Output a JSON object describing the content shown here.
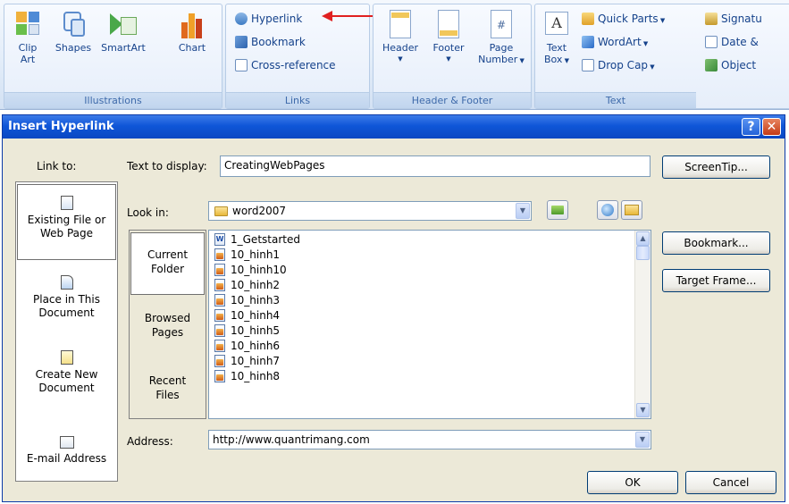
{
  "ribbon": {
    "illustrations": {
      "label": "Illustrations",
      "clip_art_1": "Clip",
      "clip_art_2": "Art",
      "shapes": "Shapes",
      "smartart": "SmartArt",
      "chart": "Chart"
    },
    "links": {
      "label": "Links",
      "hyperlink": "Hyperlink",
      "bookmark": "Bookmark",
      "cross_reference": "Cross-reference"
    },
    "header_footer": {
      "label": "Header & Footer",
      "header": "Header",
      "footer": "Footer",
      "page_number_1": "Page",
      "page_number_2": "Number"
    },
    "text": {
      "label": "Text",
      "text_box_1": "Text",
      "text_box_2": "Box",
      "quick_parts": "Quick Parts",
      "wordart": "WordArt",
      "drop_cap": "Drop Cap",
      "signature": "Signatu",
      "date_time": "Date &",
      "object": "Object"
    }
  },
  "dialog": {
    "title": "Insert Hyperlink",
    "help": "?",
    "close": "✕",
    "link_to_label": "Link to:",
    "text_to_display_label": "Text to display:",
    "text_to_display_value": "CreatingWebPages",
    "screentip": "ScreenTip...",
    "look_in_label": "Look in:",
    "look_in_value": "word2007",
    "bookmark": "Bookmark...",
    "target_frame": "Target Frame...",
    "address_label": "Address:",
    "address_value": "http://www.quantrimang.com",
    "ok": "OK",
    "cancel": "Cancel",
    "link_to": [
      {
        "line1": "Existing File or",
        "line2": "Web Page"
      },
      {
        "line1": "Place in This",
        "line2": "Document"
      },
      {
        "line1": "Create New",
        "line2": "Document"
      },
      {
        "line1": "E-mail Address",
        "line2": ""
      }
    ],
    "folder_tabs": [
      {
        "line1": "Current",
        "line2": "Folder"
      },
      {
        "line1": "Browsed",
        "line2": "Pages"
      },
      {
        "line1": "Recent",
        "line2": "Files"
      }
    ],
    "files": [
      {
        "name": "1_Getstarted",
        "type": "doc"
      },
      {
        "name": "10_hinh1",
        "type": "img"
      },
      {
        "name": "10_hinh10",
        "type": "img"
      },
      {
        "name": "10_hinh2",
        "type": "img"
      },
      {
        "name": "10_hinh3",
        "type": "img"
      },
      {
        "name": "10_hinh4",
        "type": "img"
      },
      {
        "name": "10_hinh5",
        "type": "img"
      },
      {
        "name": "10_hinh6",
        "type": "img"
      },
      {
        "name": "10_hinh7",
        "type": "img"
      },
      {
        "name": "10_hinh8",
        "type": "img"
      }
    ]
  },
  "colors": {
    "annotation_arrow": "#e02020",
    "title_bar": "#0f56d8",
    "dialog_bg": "#ece9d8"
  }
}
